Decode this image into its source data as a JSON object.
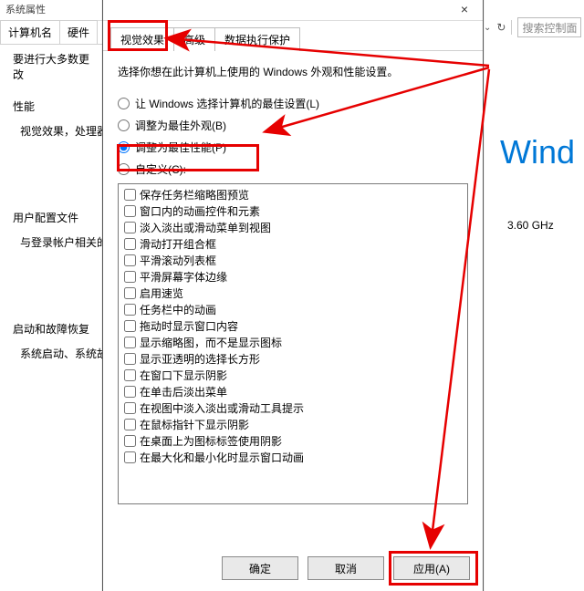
{
  "bg": {
    "title_remnant": "系统属性",
    "tabs": {
      "t0": "计算机名",
      "t1": "硬件"
    },
    "advice": "要进行大多数更改",
    "perf_title": "性能",
    "perf_sub": "视觉效果，处理器",
    "profile_title": "用户配置文件",
    "profile_sub": "与登录帐户相关的",
    "startup_title": "启动和故障恢复",
    "startup_sub": "系统启动、系统故"
  },
  "right": {
    "search_placeholder": "搜索控制面",
    "wind": "Wind",
    "ghz": "3.60 GHz"
  },
  "dlg": {
    "tabs": {
      "t0": "视觉效果",
      "t1": "高级",
      "t2": "数据执行保护"
    },
    "desc": "选择你想在此计算机上使用的 Windows 外观和性能设置。",
    "radios": {
      "r0": "让 Windows 选择计算机的最佳设置(L)",
      "r1": "调整为最佳外观(B)",
      "r2": "调整为最佳性能(P)",
      "r3": "自定义(C):"
    },
    "checks": [
      "保存任务栏缩略图预览",
      "窗口内的动画控件和元素",
      "淡入淡出或滑动菜单到视图",
      "滑动打开组合框",
      "平滑滚动列表框",
      "平滑屏幕字体边缘",
      "启用速览",
      "任务栏中的动画",
      "拖动时显示窗口内容",
      "显示缩略图，而不是显示图标",
      "显示亚透明的选择长方形",
      "在窗口下显示阴影",
      "在单击后淡出菜单",
      "在视图中淡入淡出或滑动工具提示",
      "在鼠标指针下显示阴影",
      "在桌面上为图标标签使用阴影",
      "在最大化和最小化时显示窗口动画"
    ],
    "buttons": {
      "ok": "确定",
      "cancel": "取消",
      "apply": "应用(A)"
    }
  }
}
